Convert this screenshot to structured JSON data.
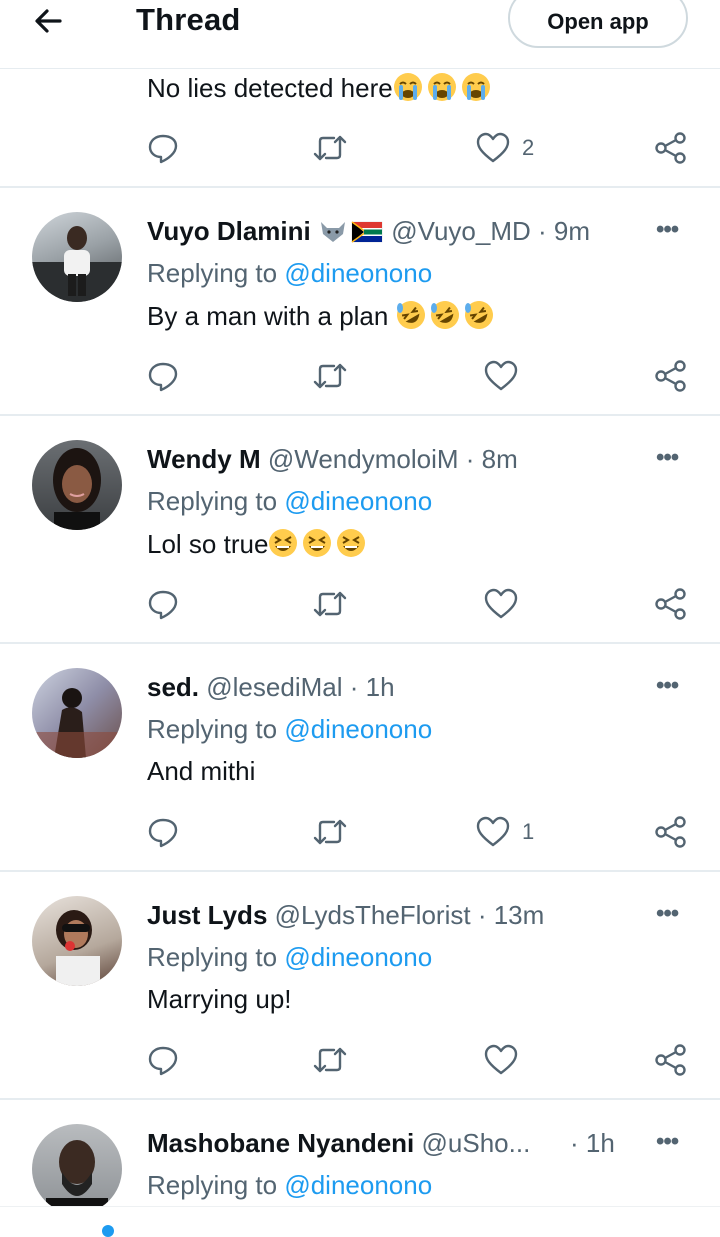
{
  "header": {
    "title": "Thread",
    "open_app": "Open app"
  },
  "top_tweet": {
    "text": "No lies detected here",
    "likes": "2"
  },
  "tweets": [
    {
      "name": "Vuyo Dlamini",
      "handle": "@Vuyo_MD",
      "time": "· 9m",
      "replying_label": "Replying to",
      "replying_to": "@dineonono",
      "text": "By a man with a plan",
      "likes": ""
    },
    {
      "name": "Wendy M",
      "handle": "@WendymoloiM",
      "time": "· 8m",
      "replying_label": "Replying to",
      "replying_to": "@dineonono",
      "text": "Lol so true",
      "likes": ""
    },
    {
      "name": "sed.",
      "handle": "@lesediMal",
      "time": "· 1h",
      "replying_label": "Replying to",
      "replying_to": "@dineonono",
      "text": "And mithi",
      "likes": "1"
    },
    {
      "name": "Just Lyds",
      "handle": "@LydsTheFlorist",
      "time": "· 13m",
      "replying_label": "Replying to",
      "replying_to": "@dineonono",
      "text": "Marrying up!",
      "likes": ""
    },
    {
      "name": "Mashobane Nyandeni",
      "handle": "@uSho...",
      "time": "· 1h",
      "replying_label": "Replying to",
      "replying_to": "@dineonono",
      "text": "",
      "likes": ""
    }
  ],
  "icons": [
    "back-arrow-icon",
    "reply-icon",
    "retweet-icon",
    "like-icon",
    "share-icon",
    "more-icon"
  ],
  "colors": {
    "accent": "#1d9bf0",
    "secondary_text": "#536471",
    "divider": "#e6ecf0"
  }
}
